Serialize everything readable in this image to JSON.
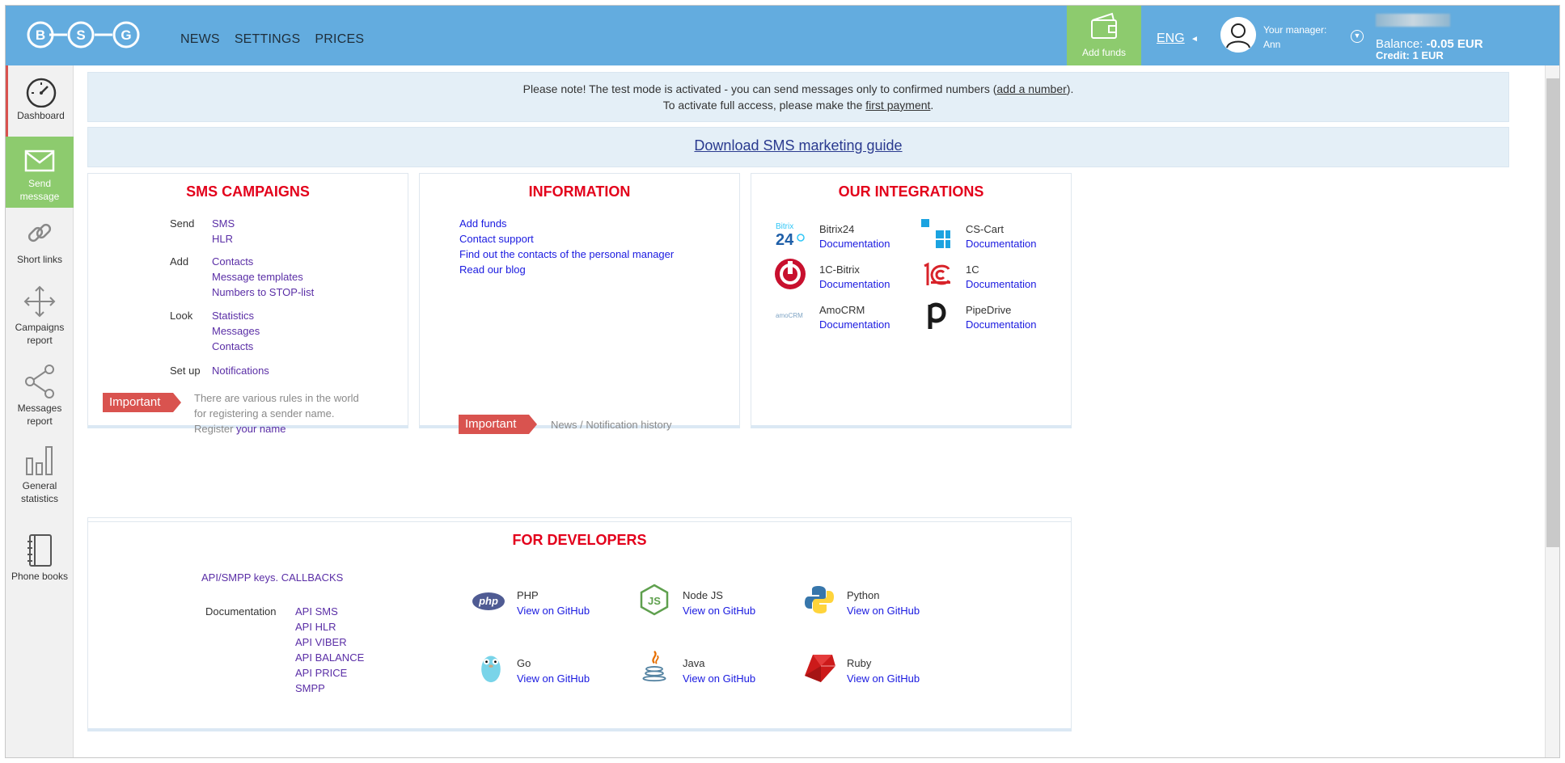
{
  "header": {
    "logo_letters": [
      "B",
      "S",
      "G"
    ],
    "nav": [
      "NEWS",
      "SETTINGS",
      "PRICES"
    ],
    "add_funds": "Add funds",
    "lang": "ENG",
    "manager_label": "Your manager:",
    "manager_name": "Ann",
    "balance_label": "Balance:",
    "balance_value": "-0.05 EUR",
    "credit": "Credit: 1 EUR"
  },
  "sidebar": [
    {
      "label": "Dashboard",
      "icon": "speedometer-icon"
    },
    {
      "label": "Send message",
      "icon": "envelope-icon"
    },
    {
      "label": "Short links",
      "icon": "link-icon"
    },
    {
      "label": "Campaigns report",
      "icon": "move-arrows-icon"
    },
    {
      "label": "Messages report",
      "icon": "share-icon"
    },
    {
      "label": "General statistics",
      "icon": "bar-chart-icon"
    },
    {
      "label": "Phone books",
      "icon": "notebook-icon"
    }
  ],
  "notice": {
    "line1_a": "Please note! The test mode is activated - you can send messages only to confirmed numbers (",
    "line1_link": "add a number",
    "line1_b": ").",
    "line2_a": "To activate full access, please make the ",
    "line2_link": "first payment",
    "line2_b": "."
  },
  "guide_link": "Download SMS marketing guide",
  "campaigns": {
    "title": "SMS CAMPAIGNS",
    "send_label": "Send",
    "send": [
      "SMS",
      "HLR"
    ],
    "add_label": "Add",
    "add": [
      "Contacts",
      "Message templates",
      "Numbers to STOP-list"
    ],
    "look_label": "Look",
    "look": [
      "Statistics",
      "Messages",
      "Contacts"
    ],
    "setup_label": "Set up",
    "setup": [
      "Notifications"
    ],
    "important": "Important",
    "rules_l1": "There are various rules in the world",
    "rules_l2": "for registering a sender name.",
    "rules_l3": "Register ",
    "rules_link": "your name"
  },
  "information": {
    "title": "INFORMATION",
    "links": [
      "Add funds",
      "Contact support",
      "Find out the contacts of the personal manager",
      "Read our blog"
    ],
    "important": "Important",
    "history": "News / Notification history"
  },
  "integrations": {
    "title": "OUR INTEGRATIONS",
    "items": [
      {
        "name": "Bitrix24",
        "link": "Documentation"
      },
      {
        "name": "CS-Cart",
        "link": "Documentation"
      },
      {
        "name": "1C-Bitrix",
        "link": "Documentation"
      },
      {
        "name": "1C",
        "link": "Documentation"
      },
      {
        "name": "AmoCRM",
        "link": "Documentation"
      },
      {
        "name": "PipeDrive",
        "link": "Documentation"
      }
    ],
    "logo_text": {
      "bitrix": "Bitrix",
      "bitrix_num": "24",
      "amo": "amoCRM"
    }
  },
  "developers": {
    "title": "FOR DEVELOPERS",
    "keys": "API/SMPP keys. CALLBACKS",
    "doc_label": "Documentation",
    "docs": [
      "API SMS",
      "API HLR",
      "API VIBER",
      "API BALANCE",
      "API PRICE",
      "SMPP"
    ],
    "langs": [
      {
        "name": "PHP",
        "link": "View on GitHub"
      },
      {
        "name": "Node JS",
        "link": "View on GitHub"
      },
      {
        "name": "Python",
        "link": "View on GitHub"
      },
      {
        "name": "Go",
        "link": "View on GitHub"
      },
      {
        "name": "Java",
        "link": "View on GitHub"
      },
      {
        "name": "Ruby",
        "link": "View on GitHub"
      }
    ],
    "logo_text": {
      "php": "php",
      "node": "JS"
    }
  },
  "colors": {
    "header_bg": "#63acdf",
    "green": "#8dcb6e",
    "red_title": "#e3001b",
    "important": "#d9534f",
    "link": "#1a1ae0"
  }
}
